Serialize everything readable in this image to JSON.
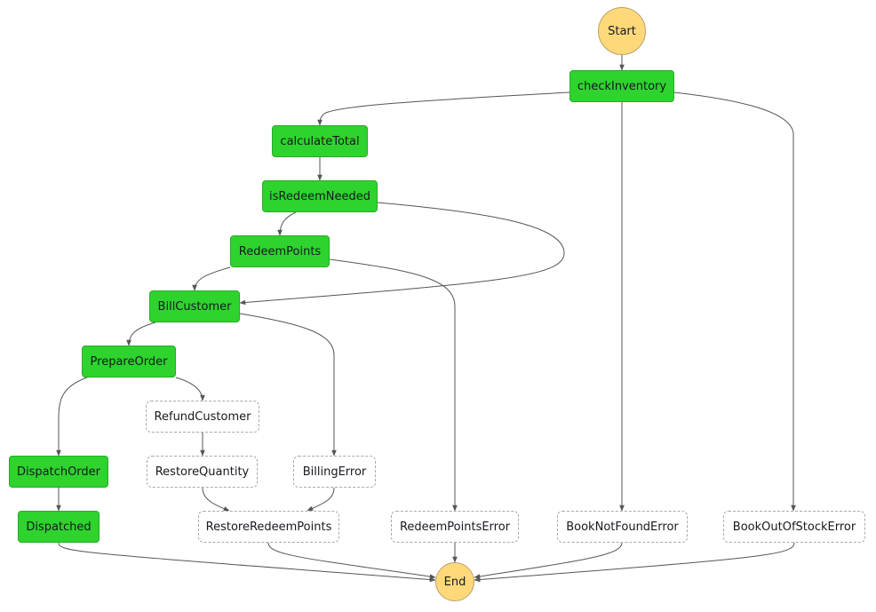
{
  "diagram": {
    "type": "state-machine-graph",
    "colors": {
      "succeeded": "#2ed32e",
      "not_executed": "#ffffff",
      "terminal": "#ffd979",
      "edge": "#555555"
    },
    "nodes": [
      {
        "id": "Start",
        "label": "Start",
        "kind": "terminal"
      },
      {
        "id": "checkInventory",
        "label": "checkInventory",
        "kind": "success"
      },
      {
        "id": "calculateTotal",
        "label": "calculateTotal",
        "kind": "success"
      },
      {
        "id": "isRedeemNeeded",
        "label": "isRedeemNeeded",
        "kind": "success"
      },
      {
        "id": "RedeemPoints",
        "label": "RedeemPoints",
        "kind": "success"
      },
      {
        "id": "BillCustomer",
        "label": "BillCustomer",
        "kind": "success"
      },
      {
        "id": "PrepareOrder",
        "label": "PrepareOrder",
        "kind": "success"
      },
      {
        "id": "RefundCustomer",
        "label": "RefundCustomer",
        "kind": "notrun"
      },
      {
        "id": "DispatchOrder",
        "label": "DispatchOrder",
        "kind": "success"
      },
      {
        "id": "RestoreQuantity",
        "label": "RestoreQuantity",
        "kind": "notrun"
      },
      {
        "id": "BillingError",
        "label": "BillingError",
        "kind": "notrun"
      },
      {
        "id": "Dispatched",
        "label": "Dispatched",
        "kind": "success"
      },
      {
        "id": "RestoreRedeemPoints",
        "label": "RestoreRedeemPoints",
        "kind": "notrun"
      },
      {
        "id": "RedeemPointsError",
        "label": "RedeemPointsError",
        "kind": "notrun"
      },
      {
        "id": "BookNotFoundError",
        "label": "BookNotFoundError",
        "kind": "notrun"
      },
      {
        "id": "BookOutOfStockError",
        "label": "BookOutOfStockError",
        "kind": "notrun"
      },
      {
        "id": "End",
        "label": "End",
        "kind": "terminal"
      }
    ],
    "edges": [
      {
        "from": "Start",
        "to": "checkInventory"
      },
      {
        "from": "checkInventory",
        "to": "calculateTotal"
      },
      {
        "from": "checkInventory",
        "to": "BookNotFoundError"
      },
      {
        "from": "checkInventory",
        "to": "BookOutOfStockError"
      },
      {
        "from": "calculateTotal",
        "to": "isRedeemNeeded"
      },
      {
        "from": "isRedeemNeeded",
        "to": "RedeemPoints"
      },
      {
        "from": "isRedeemNeeded",
        "to": "BillCustomer"
      },
      {
        "from": "RedeemPoints",
        "to": "BillCustomer"
      },
      {
        "from": "RedeemPoints",
        "to": "RedeemPointsError"
      },
      {
        "from": "BillCustomer",
        "to": "PrepareOrder"
      },
      {
        "from": "BillCustomer",
        "to": "BillingError"
      },
      {
        "from": "PrepareOrder",
        "to": "DispatchOrder"
      },
      {
        "from": "PrepareOrder",
        "to": "RefundCustomer"
      },
      {
        "from": "RefundCustomer",
        "to": "RestoreQuantity"
      },
      {
        "from": "RestoreQuantity",
        "to": "RestoreRedeemPoints"
      },
      {
        "from": "BillingError",
        "to": "RestoreRedeemPoints"
      },
      {
        "from": "DispatchOrder",
        "to": "Dispatched"
      },
      {
        "from": "Dispatched",
        "to": "End"
      },
      {
        "from": "RestoreRedeemPoints",
        "to": "End"
      },
      {
        "from": "RedeemPointsError",
        "to": "End"
      },
      {
        "from": "BookNotFoundError",
        "to": "End"
      },
      {
        "from": "BookOutOfStockError",
        "to": "End"
      }
    ]
  }
}
